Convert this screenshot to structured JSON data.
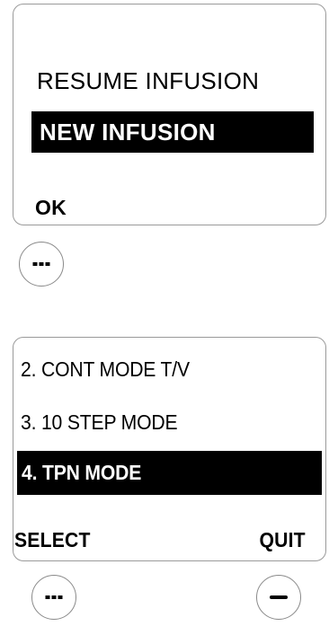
{
  "screen1": {
    "items": [
      "RESUME INFUSION",
      "NEW INFUSION"
    ],
    "selected_index": 1,
    "left_soft_key_label": "OK"
  },
  "screen2": {
    "items": [
      "2. CONT  MODE T/V",
      "3. 10 STEP MODE",
      "4. TPN MODE"
    ],
    "selected_index": 2,
    "left_soft_key_label": "SELECT",
    "right_soft_key_label": "QUIT"
  },
  "keys": {
    "screen1_left": "dotted-dash-icon",
    "screen2_left": "dotted-dash-icon",
    "screen2_right": "dash-icon"
  }
}
